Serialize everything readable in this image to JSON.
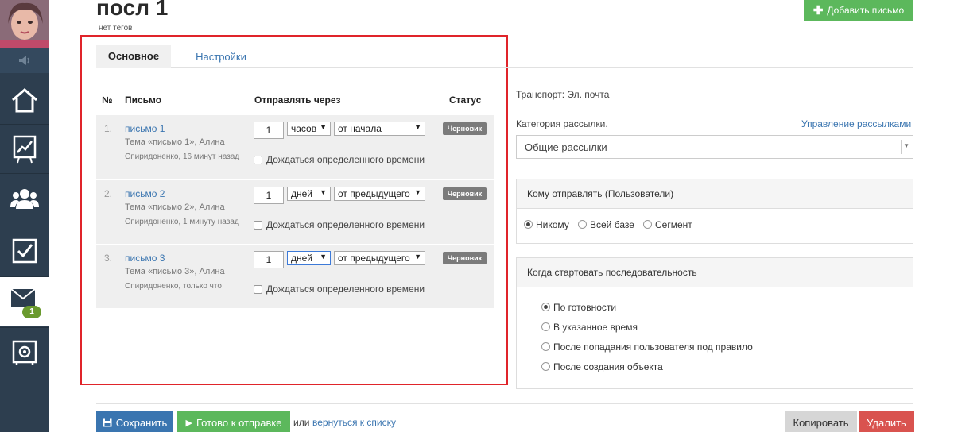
{
  "header": {
    "title": "посл 1",
    "tags": "нет тегов",
    "add_button": "Добавить письмо"
  },
  "sidebar": {
    "items": [
      {
        "icon": "home-icon"
      },
      {
        "icon": "chart-icon"
      },
      {
        "icon": "users-icon"
      },
      {
        "icon": "checkbox-icon"
      },
      {
        "icon": "mail-icon",
        "active": true,
        "badge": "1"
      },
      {
        "icon": "safe-icon"
      }
    ]
  },
  "tabs": [
    {
      "label": "Основное",
      "active": true
    },
    {
      "label": "Настройки",
      "active": false
    }
  ],
  "table": {
    "columns": {
      "num": "№",
      "letter": "Письмо",
      "send_after": "Отправлять через",
      "status": "Статус"
    },
    "rows": [
      {
        "num": "1.",
        "link": "письмо 1",
        "topic": "Тема «письмо 1», Алина",
        "author": "Спиридоненко, 16 минут назад",
        "qty": "1",
        "unit": "часов",
        "from": "от начала",
        "wait": "Дождаться определенного времени",
        "status": "Черновик"
      },
      {
        "num": "2.",
        "link": "письмо 2",
        "topic": "Тема «письмо 2», Алина",
        "author": "Спиридоненко, 1 минуту назад",
        "qty": "1",
        "unit": "дней",
        "from": "от предыдущего",
        "wait": "Дождаться определенного времени",
        "status": "Черновик"
      },
      {
        "num": "3.",
        "link": "письмо 3",
        "topic": "Тема «письмо 3», Алина",
        "author": "Спиридоненко, только что",
        "qty": "1",
        "unit": "дней",
        "from": "от предыдущего",
        "wait": "Дождаться определенного времени",
        "status": "Черновик"
      }
    ]
  },
  "right": {
    "transport": "Транспорт: Эл. почта",
    "category_label": "Категория рассылки.",
    "manage_link": "Управление рассылками",
    "category_value": "Общие рассылки",
    "recipients": {
      "title": "Кому отправлять (Пользователи)",
      "options": [
        "Никому",
        "Всей базе",
        "Сегмент"
      ],
      "selected": 0
    },
    "start": {
      "title": "Когда стартовать последовательность",
      "options": [
        "По готовности",
        "В указанное время",
        "После попадания пользователя под правило",
        "После создания объекта"
      ],
      "selected": 0
    }
  },
  "footer": {
    "save": "Сохранить",
    "ready": "Готово к отправке",
    "or": "или",
    "back": "вернуться к списку",
    "copy": "Копировать",
    "delete": "Удалить"
  },
  "colors": {
    "sidebar": "#2d3e4f",
    "accent_blue": "#3a75b0",
    "accent_green": "#5cb85c",
    "danger": "#d9534f",
    "highlight_box": "#e0242a"
  }
}
